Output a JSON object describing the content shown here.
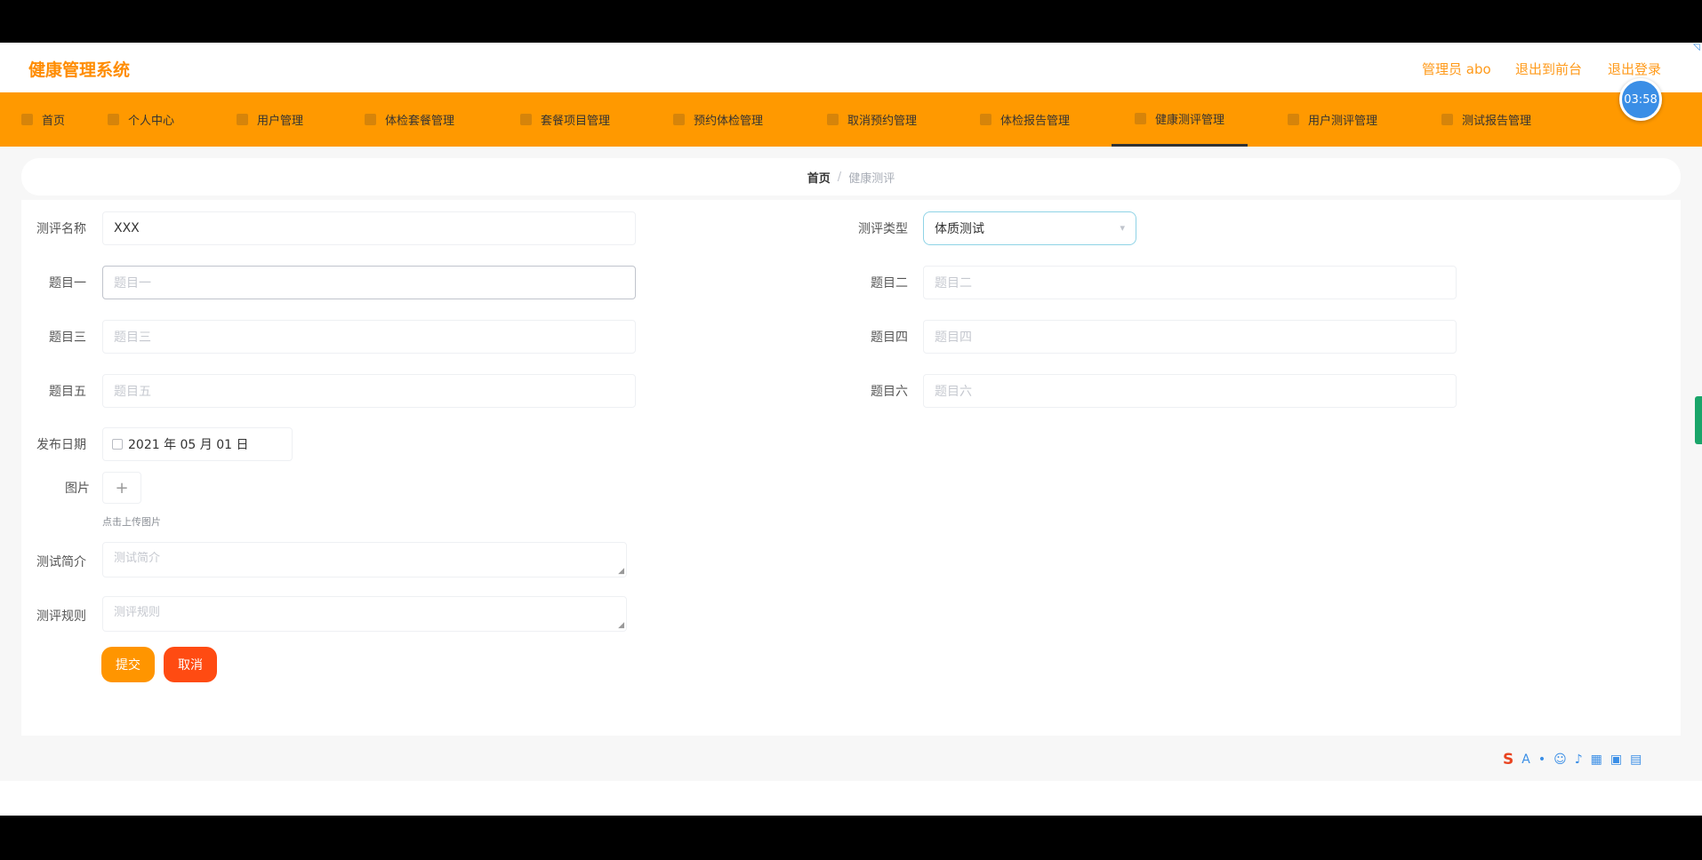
{
  "header": {
    "title": "健康管理系统",
    "links": [
      "管理员 abo",
      "退出到前台",
      "退出登录"
    ]
  },
  "clock": "03:58",
  "nav": {
    "items": [
      {
        "label": "首页",
        "icon": "home-icon"
      },
      {
        "label": "个人中心",
        "icon": "user-icon"
      },
      {
        "label": "用户管理",
        "icon": "users-icon"
      },
      {
        "label": "体检套餐管理",
        "icon": "grid-icon"
      },
      {
        "label": "套餐项目管理",
        "icon": "grid-icon"
      },
      {
        "label": "预约体检管理",
        "icon": "document-icon"
      },
      {
        "label": "取消预约管理",
        "icon": "grid-icon"
      },
      {
        "label": "体检报告管理",
        "icon": "grid-icon"
      },
      {
        "label": "健康测评管理",
        "icon": "grid-icon",
        "active": true
      },
      {
        "label": "用户测评管理",
        "icon": "grid-icon"
      },
      {
        "label": "测试报告管理",
        "icon": "document-icon"
      }
    ]
  },
  "breadcrumb": {
    "home": "首页",
    "separator": "/",
    "current": "健康测评"
  },
  "form": {
    "name": {
      "label": "测评名称",
      "value": "XXX"
    },
    "type": {
      "label": "测评类型",
      "value": "体质测试"
    },
    "q1": {
      "label": "题目一",
      "placeholder": "题目一"
    },
    "q2": {
      "label": "题目二",
      "placeholder": "题目二"
    },
    "q3": {
      "label": "题目三",
      "placeholder": "题目三"
    },
    "q4": {
      "label": "题目四",
      "placeholder": "题目四"
    },
    "q5": {
      "label": "题目五",
      "placeholder": "题目五"
    },
    "q6": {
      "label": "题目六",
      "placeholder": "题目六"
    },
    "date": {
      "label": "发布日期",
      "value": "2021 年 05 月 01 日"
    },
    "image": {
      "label": "图片",
      "hint": "点击上传图片"
    },
    "intro": {
      "label": "测试简介",
      "placeholder": "测试简介"
    },
    "rules": {
      "label": "测评规则",
      "placeholder": "测评规则"
    },
    "submit": "提交",
    "cancel": "取消"
  },
  "colors": {
    "brand_orange": "#ff9900",
    "title_orange": "#ff8c00",
    "submit": "#ff9500",
    "cancel": "#ff4b12",
    "clock_blue": "#3a8ee6"
  }
}
